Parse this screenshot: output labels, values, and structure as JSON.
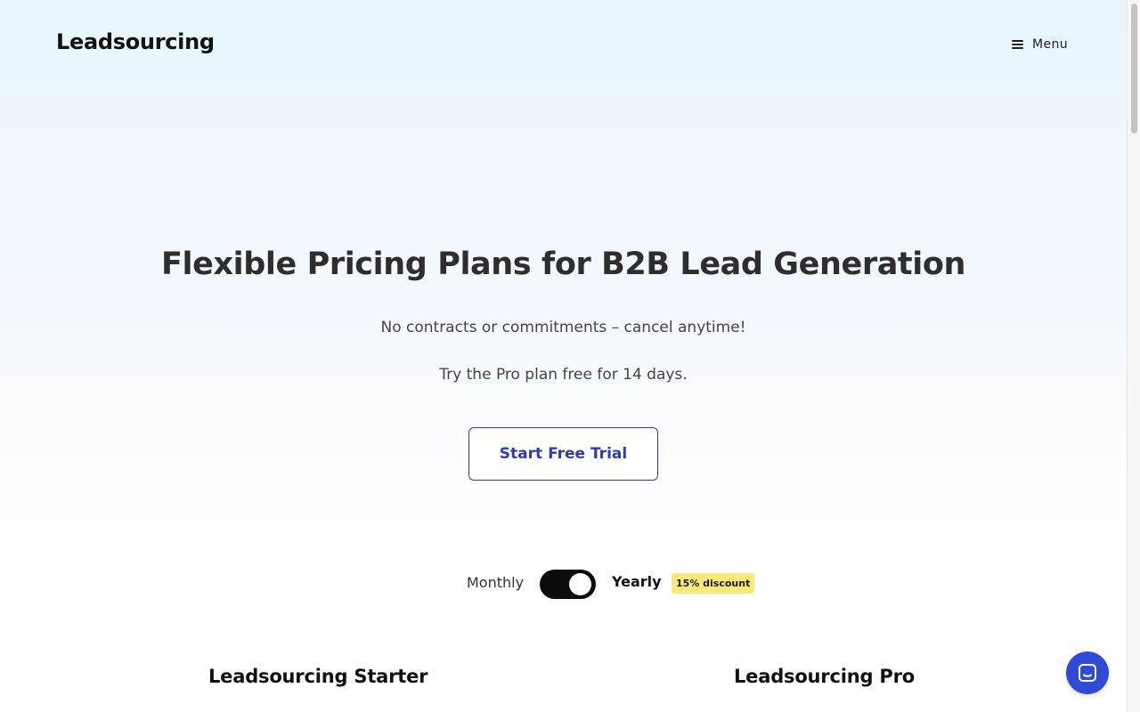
{
  "header": {
    "logo": "Leadsourcing",
    "menu_label": "Menu"
  },
  "hero": {
    "title": "Flexible Pricing Plans for B2B Lead Generation",
    "subtitle_1": "No contracts or commitments – cancel anytime!",
    "subtitle_2": "Try the Pro plan free for 14 days.",
    "cta_label": "Start Free Trial"
  },
  "billing": {
    "monthly_label": "Monthly",
    "yearly_label": "Yearly",
    "discount_badge": "15% discount",
    "selected": "Yearly"
  },
  "plans": [
    {
      "name": "Leadsourcing Starter"
    },
    {
      "name": "Leadsourcing Pro"
    }
  ],
  "icons": {
    "menu": "hamburger-icon",
    "chat": "chat-icon"
  },
  "colors": {
    "accent": "#2f3bb0",
    "chat_button": "#2f4bd6",
    "badge": "#fde97a",
    "toggle_on": "#0c0c0c"
  }
}
